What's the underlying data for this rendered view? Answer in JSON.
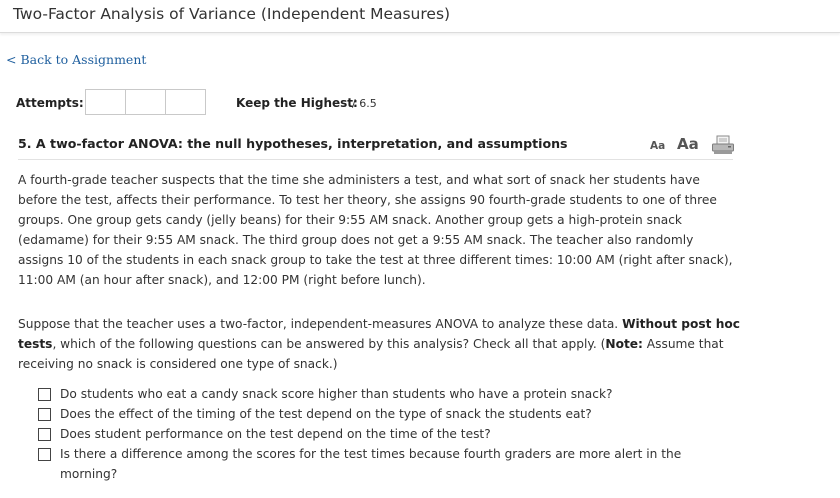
{
  "header": {
    "title": "Two-Factor Analysis of Variance (Independent Measures)"
  },
  "nav": {
    "back_label": "< Back to Assignment"
  },
  "attempts": {
    "label": "Attempts:",
    "keep_label": "Keep the Highest:",
    "score": "/ 6.5"
  },
  "question": {
    "title": "5. A two-factor ANOVA: the null hypotheses, interpretation, and assumptions",
    "font_small": "Aa",
    "font_large": "Aa",
    "paragraph1": "A fourth-grade teacher suspects that the time she administers a test, and what sort of snack her students have before the test, affects their performance. To test her theory, she assigns 90 fourth-grade students to one of three groups. One group gets candy (jelly beans) for their 9:55 AM snack. Another group gets a high-protein snack (edamame) for their 9:55 AM snack. The third group does not get a 9:55 AM snack. The teacher also randomly assigns 10 of the students in each snack group to take the test at three different times: 10:00 AM (right after snack), 11:00 AM (an hour after snack), and 12:00 PM (right before lunch).",
    "p2_a": "Suppose that the teacher uses a two-factor, independent-measures ANOVA to analyze these data. ",
    "p2_b": "Without post hoc tests",
    "p2_c": ", which of the following questions can be answered by this analysis? Check all that apply. (",
    "p2_d": "Note:",
    "p2_e": " Assume that receiving no snack is considered one type of snack.)",
    "options": [
      "Do students who eat a candy snack score higher than students who have a protein snack?",
      "Does the effect of the timing of the test depend on the type of snack the students eat?",
      "Does student performance on the test depend on the time of the test?",
      "Is there a difference among the scores for the test times because fourth graders are more alert in the morning?"
    ]
  },
  "colors": {
    "link": "#1f5f9e",
    "text": "#333333"
  },
  "icons": {
    "print": "printer-icon"
  }
}
